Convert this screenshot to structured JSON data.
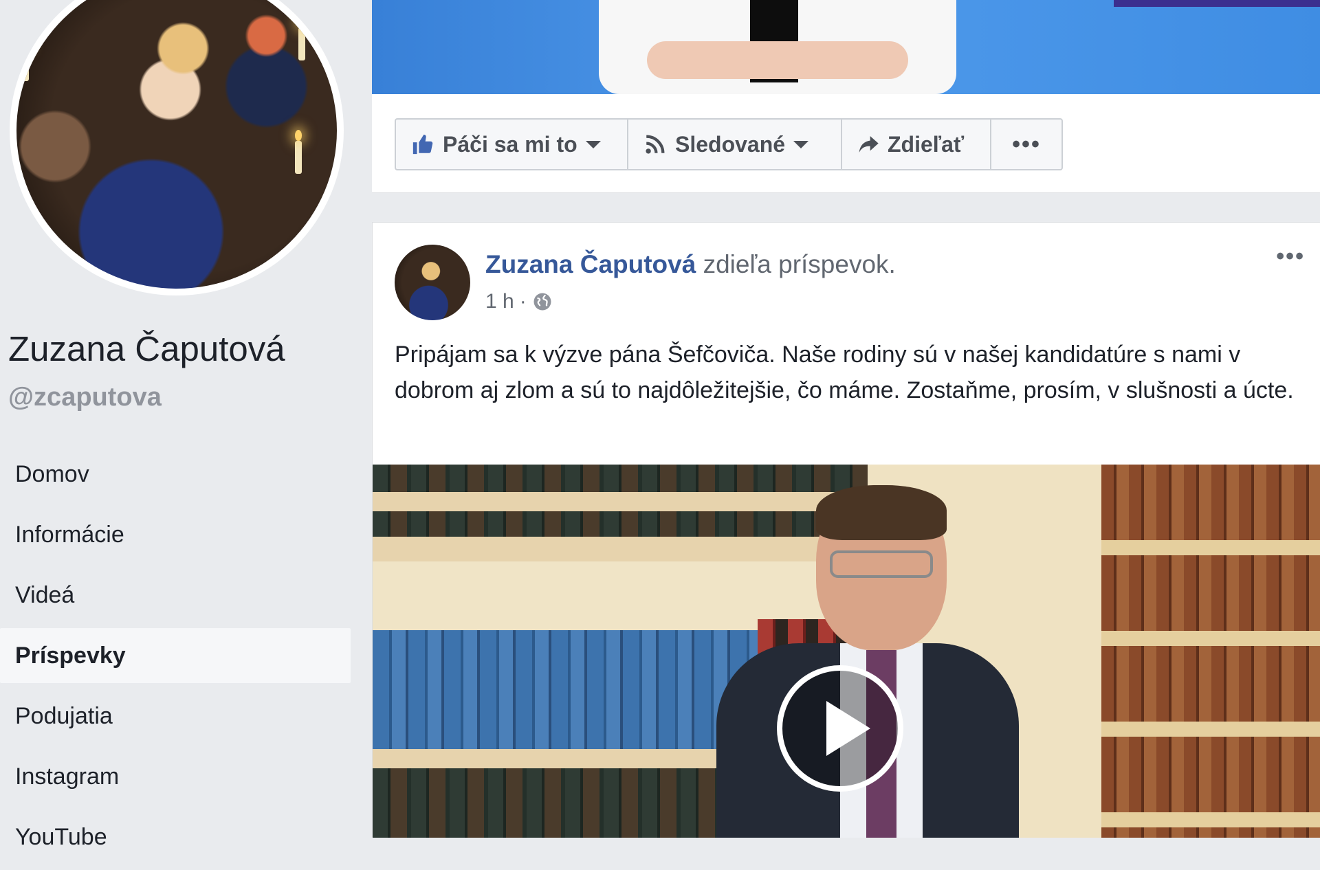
{
  "colors": {
    "link": "#365899",
    "page_bg": "#e9ebee",
    "cover_blue": "#4f9aeb",
    "secondary_text": "#616770",
    "icon_blue": "#4267b2"
  },
  "profile": {
    "name": "Zuzana Čaputová",
    "username": "@zcaputova"
  },
  "nav": {
    "items": [
      {
        "label": "Domov",
        "active": false
      },
      {
        "label": "Informácie",
        "active": false
      },
      {
        "label": "Videá",
        "active": false
      },
      {
        "label": "Príspevky",
        "active": true
      },
      {
        "label": "Podujatia",
        "active": false
      },
      {
        "label": "Instagram",
        "active": false
      },
      {
        "label": "YouTube",
        "active": false
      }
    ]
  },
  "action_bar": {
    "like_label": "Páči sa mi to",
    "follow_label": "Sledované",
    "share_label": "Zdieľať",
    "more_label": "•••",
    "icons": [
      "thumbs-up-icon",
      "rss-icon",
      "share-arrow-icon"
    ]
  },
  "post": {
    "author": "Zuzana Čaputová",
    "action": "zdieľa príspevok.",
    "time": "1 h",
    "separator": "·",
    "audience_icon": "globe-icon",
    "options_label": "•••",
    "text": "Pripájam sa k výzve pána Šefčoviča. Naše rodiny sú v našej kandidatúre s nami v dobrom aj zlom a sú to najdôležitejšie, čo máme. Zostaňme, prosím, v slušnosti a úcte.",
    "media_type": "video",
    "play_icon": "play-icon"
  }
}
